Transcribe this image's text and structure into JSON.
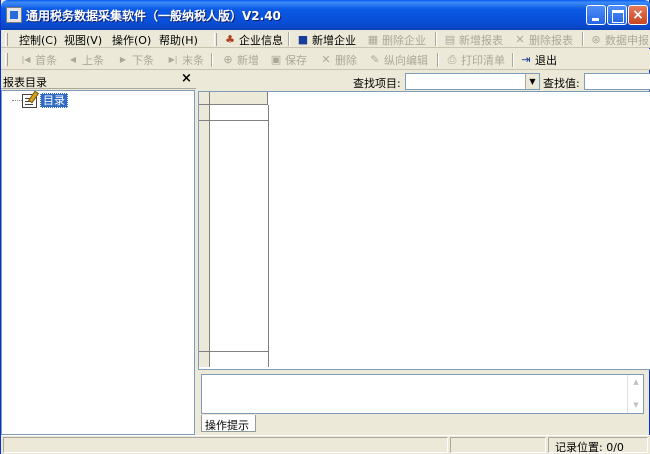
{
  "window": {
    "title": "通用税务数据采集软件（一般纳税人版）V2.40",
    "controls": {
      "minimize": "minimize",
      "maximize": "maximize",
      "close": "×"
    }
  },
  "menubar": {
    "menus": [
      "控制(C)",
      "视图(V)",
      "操作(O)",
      "帮助(H)"
    ],
    "tools": [
      {
        "label": "企业信息",
        "icon": "company-info-icon",
        "enabled": true
      },
      {
        "label": "新增企业",
        "icon": "add-company-icon",
        "enabled": true
      },
      {
        "label": "删除企业",
        "icon": "delete-company-icon",
        "enabled": false
      },
      {
        "label": "新增报表",
        "icon": "add-report-icon",
        "enabled": false
      },
      {
        "label": "删除报表",
        "icon": "delete-report-icon",
        "enabled": false
      },
      {
        "label": "数据申报",
        "icon": "data-declare-icon",
        "enabled": false
      }
    ]
  },
  "toolbar": {
    "nav": [
      {
        "label": "首条",
        "icon": "first-record-icon",
        "enabled": false
      },
      {
        "label": "上条",
        "icon": "prev-record-icon",
        "enabled": false
      },
      {
        "label": "下条",
        "icon": "next-record-icon",
        "enabled": false
      },
      {
        "label": "末条",
        "icon": "last-record-icon",
        "enabled": false
      }
    ],
    "actions": [
      {
        "label": "新增",
        "icon": "new-icon",
        "enabled": false
      },
      {
        "label": "保存",
        "icon": "save-icon",
        "enabled": false
      },
      {
        "label": "删除",
        "icon": "delete-icon",
        "enabled": false
      },
      {
        "label": "纵向编辑",
        "icon": "vertical-edit-icon",
        "enabled": false
      },
      {
        "label": "打印清单",
        "icon": "print-list-icon",
        "enabled": false
      },
      {
        "label": "退出",
        "icon": "exit-icon",
        "enabled": true
      }
    ]
  },
  "left_panel": {
    "title": "报表目录",
    "close_label": "×",
    "tree_root": "目录"
  },
  "search": {
    "item_label": "查找项目:",
    "item_value": "",
    "value_label": "查找值:",
    "value_value": ""
  },
  "hint_tab": "操作提示",
  "status": {
    "record_position": "记录位置: 0/0"
  }
}
